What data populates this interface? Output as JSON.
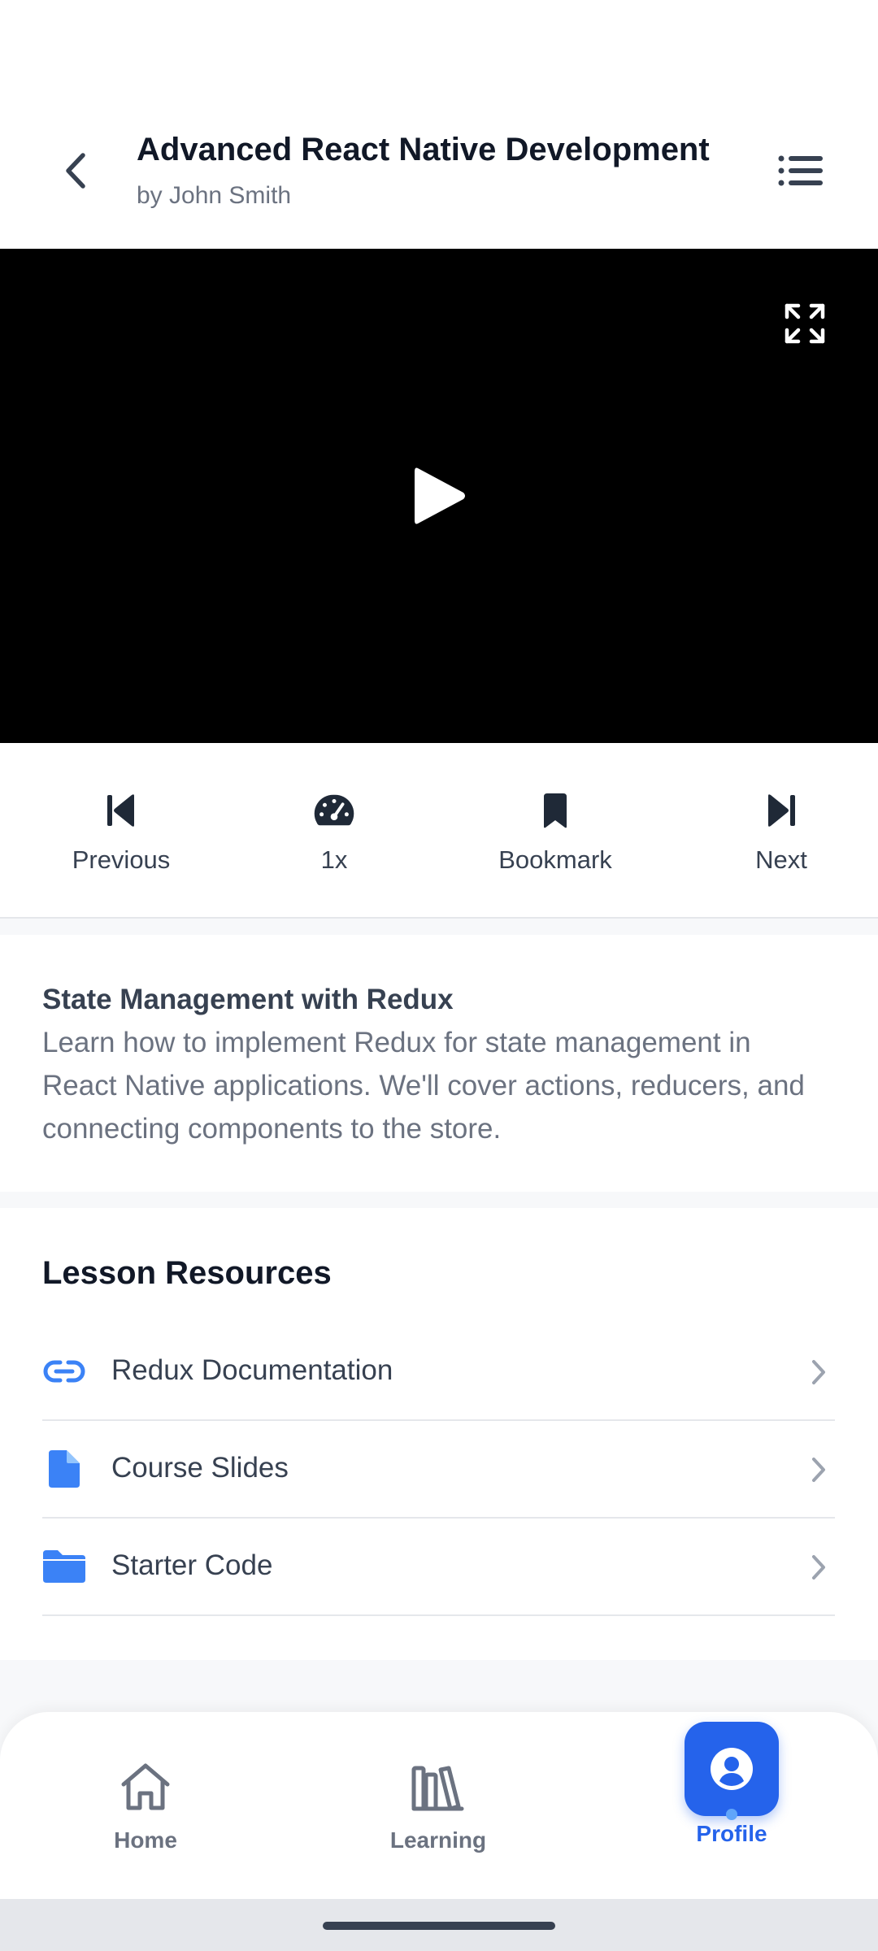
{
  "header": {
    "title": "Advanced React Native Development",
    "author": "by John Smith",
    "icons": {
      "back": "chevron-left-icon",
      "menu": "list-icon"
    }
  },
  "video": {
    "icons": {
      "fullscreen": "expand-icon",
      "play": "play-icon"
    }
  },
  "controls": [
    {
      "label": "Previous",
      "icon": "skip-back-icon"
    },
    {
      "label": "1x",
      "icon": "speedometer-icon"
    },
    {
      "label": "Bookmark",
      "icon": "bookmark-icon"
    },
    {
      "label": "Next",
      "icon": "skip-forward-icon"
    }
  ],
  "lesson": {
    "title": "State Management with Redux",
    "description": "Learn how to implement Redux for state management in React Native applications. We'll cover actions, reducers, and connecting components to the store."
  },
  "resources": {
    "heading": "Lesson Resources",
    "items": [
      {
        "label": "Redux Documentation",
        "icon": "link-icon"
      },
      {
        "label": "Course Slides",
        "icon": "file-icon"
      },
      {
        "label": "Starter Code",
        "icon": "folder-icon"
      }
    ]
  },
  "tabbar": {
    "tabs": [
      {
        "label": "Home",
        "icon": "home-icon"
      },
      {
        "label": "Learning",
        "icon": "library-icon"
      },
      {
        "label": "Profile",
        "icon": "user-circle-icon",
        "active": true
      }
    ]
  },
  "colors": {
    "accent": "#2563EB",
    "text_primary": "#111827",
    "text_secondary": "#6B7280",
    "icon_dark": "#374151"
  }
}
